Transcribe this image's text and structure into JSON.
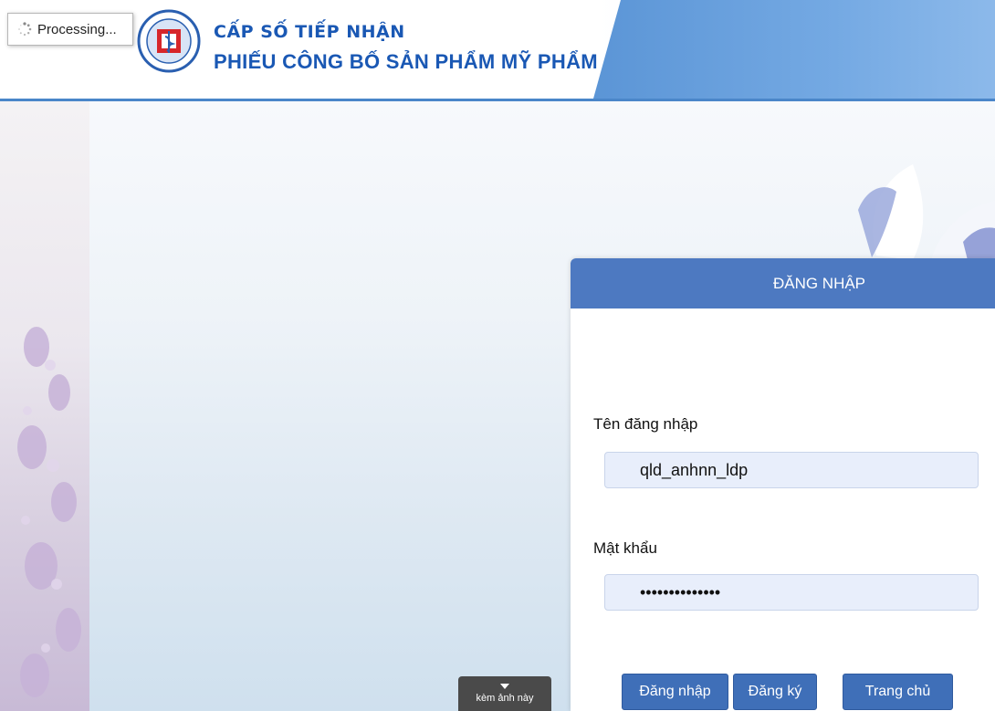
{
  "header": {
    "brand_line1": "CẤP SỐ TIẾP NHẬN",
    "brand_line2": "PHIẾU CÔNG BỐ SẢN PHẨM MỸ PHẨM",
    "processing": "Processing..."
  },
  "login": {
    "title": "ĐĂNG NHẬP",
    "username_label": "Tên đăng nhập",
    "username_value": "qld_anhnn_ldp",
    "password_label": "Mật khẩu",
    "password_value": "••••••••••••••",
    "buttons": {
      "login": "Đăng nhập",
      "register": "Đăng ký",
      "home": "Trang chủ"
    }
  },
  "tooltip": {
    "icon": "caret-down-icon",
    "text": "kèm ảnh này"
  },
  "colors": {
    "header_blue": "#4a86c9",
    "card_head": "#4d79c1",
    "button": "#3f6fb8"
  }
}
